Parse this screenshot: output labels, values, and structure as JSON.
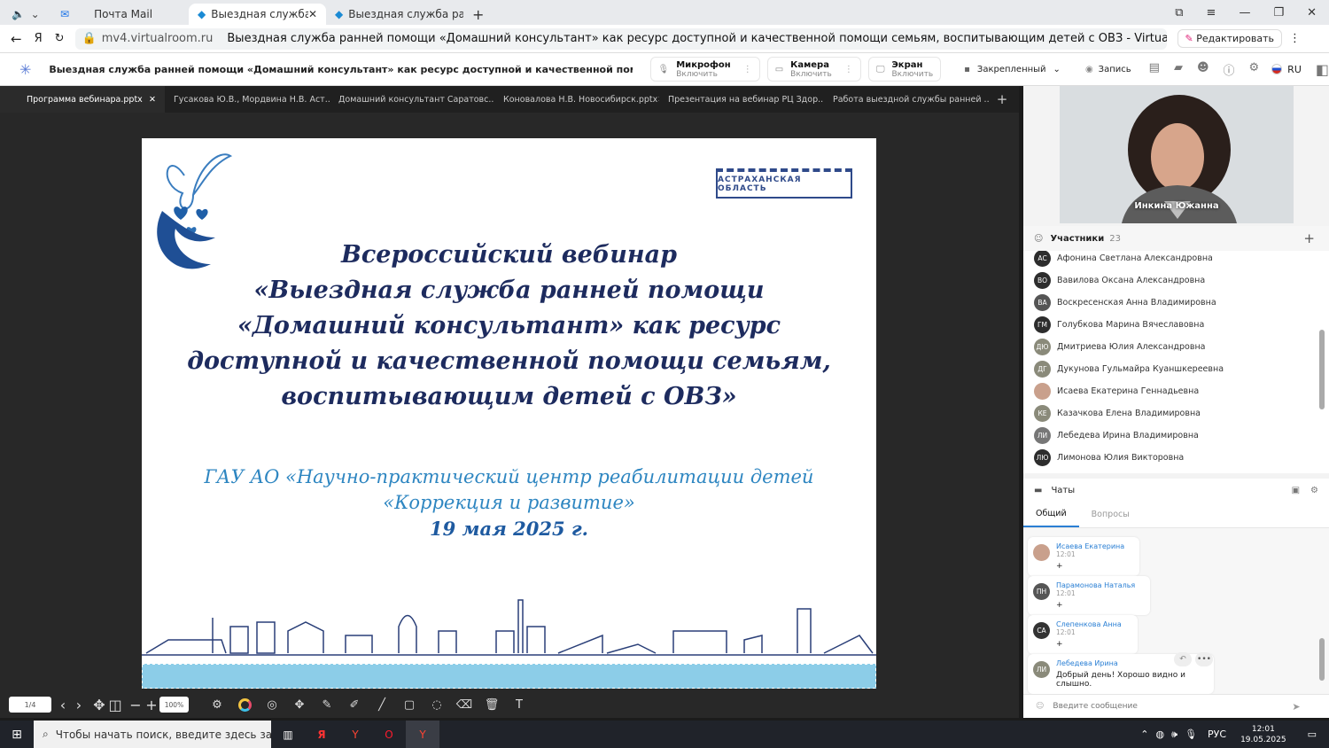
{
  "browser": {
    "tabs": [
      {
        "label": "Почта Mail"
      },
      {
        "label": "Выездная служба р"
      },
      {
        "label": "Выездная служба ранней"
      }
    ],
    "url": "mv4.virtualroom.ru",
    "page_title": "Выездная служба ранней помощи «Домашний консультант» как ресурс доступной и качественной помощи семьям, воспитывающим детей с ОВЗ - Virtual Room",
    "edit_label": "Редактировать"
  },
  "app": {
    "title": "Выездная служба ранней помощи «Домашний консультант» как ресурс доступной и качественной помощи семьям, воспиты...",
    "mic": {
      "label": "Микрофон",
      "sub": "Включить"
    },
    "camera": {
      "label": "Камера",
      "sub": "Включить"
    },
    "screen": {
      "label": "Экран",
      "sub": "Включить"
    },
    "pinned": "Закрепленный",
    "record": "Запись",
    "lang": "RU"
  },
  "doc_tabs": [
    "Программа вебинара.pptx",
    "Гусакова Ю.В., Мордвина Н.В. Аст...",
    "Домашний консультант Саратовс...",
    "Коновалова Н.В. Новосибирск.pptx",
    "Презентация на вебинар РЦ Здор...",
    "Работа выездной службы ранней ..."
  ],
  "slide": {
    "region": "АСТРАХАНСКАЯ ОБЛАСТЬ",
    "title_lines": [
      "Всероссийский вебинар",
      "«Выездная служба ранней помощи",
      "«Домашний консультант» как ресурс",
      "доступной и качественной помощи семьям,",
      "воспитывающим детей с ОВЗ»"
    ],
    "org_lines": [
      "ГАУ АО «Научно-практический центр реабилитации детей",
      "«Коррекция и развитие»"
    ],
    "date": "19 мая 2025 г."
  },
  "viewer": {
    "page": "1/4",
    "zoom": "100%"
  },
  "video": {
    "name": "Инкина Южанна"
  },
  "participants": {
    "label": "Участники",
    "count": "23",
    "list": [
      {
        "initials": "АС",
        "name": "Афонина Светлана Александровна"
      },
      {
        "initials": "ВО",
        "name": "Вавилова Оксана Александровна"
      },
      {
        "initials": "ВА",
        "name": "Воскресенская Анна Владимировна"
      },
      {
        "initials": "ГМ",
        "name": "Голубкова Марина Вячеславовна"
      },
      {
        "initials": "ДЮ",
        "name": "Дмитриева Юлия Александровна"
      },
      {
        "initials": "ДГ",
        "name": "Дукунова Гульмайра Куаншкереевна"
      },
      {
        "initials": "",
        "name": "Исаева Екатерина Геннадьевна"
      },
      {
        "initials": "КЕ",
        "name": "Казачкова Елена Владимировна"
      },
      {
        "initials": "ЛИ",
        "name": "Лебедева Ирина Владимировна"
      },
      {
        "initials": "ЛЮ",
        "name": "Лимонова Юлия Викторовна"
      }
    ]
  },
  "chat": {
    "label": "Чаты",
    "tab_general": "Общий",
    "tab_questions": "Вопросы",
    "messages": [
      {
        "initials": "",
        "name": "Исаева Екатерина",
        "time": "12:01",
        "text": "+"
      },
      {
        "initials": "ПН",
        "name": "Парамонова Наталья",
        "time": "12:01",
        "text": "+"
      },
      {
        "initials": "СА",
        "name": "Слепенкова Анна",
        "time": "12:01",
        "text": "+"
      },
      {
        "initials": "ЛИ",
        "name": "Лебедева Ирина",
        "time": "",
        "text": "Добрый день! Хорошо видно и слышно."
      }
    ],
    "placeholder": "Введите сообщение"
  },
  "taskbar": {
    "search": "Чтобы начать поиск, введите здесь запрос",
    "lang": "РУС",
    "time": "12:01",
    "date": "19.05.2025"
  }
}
